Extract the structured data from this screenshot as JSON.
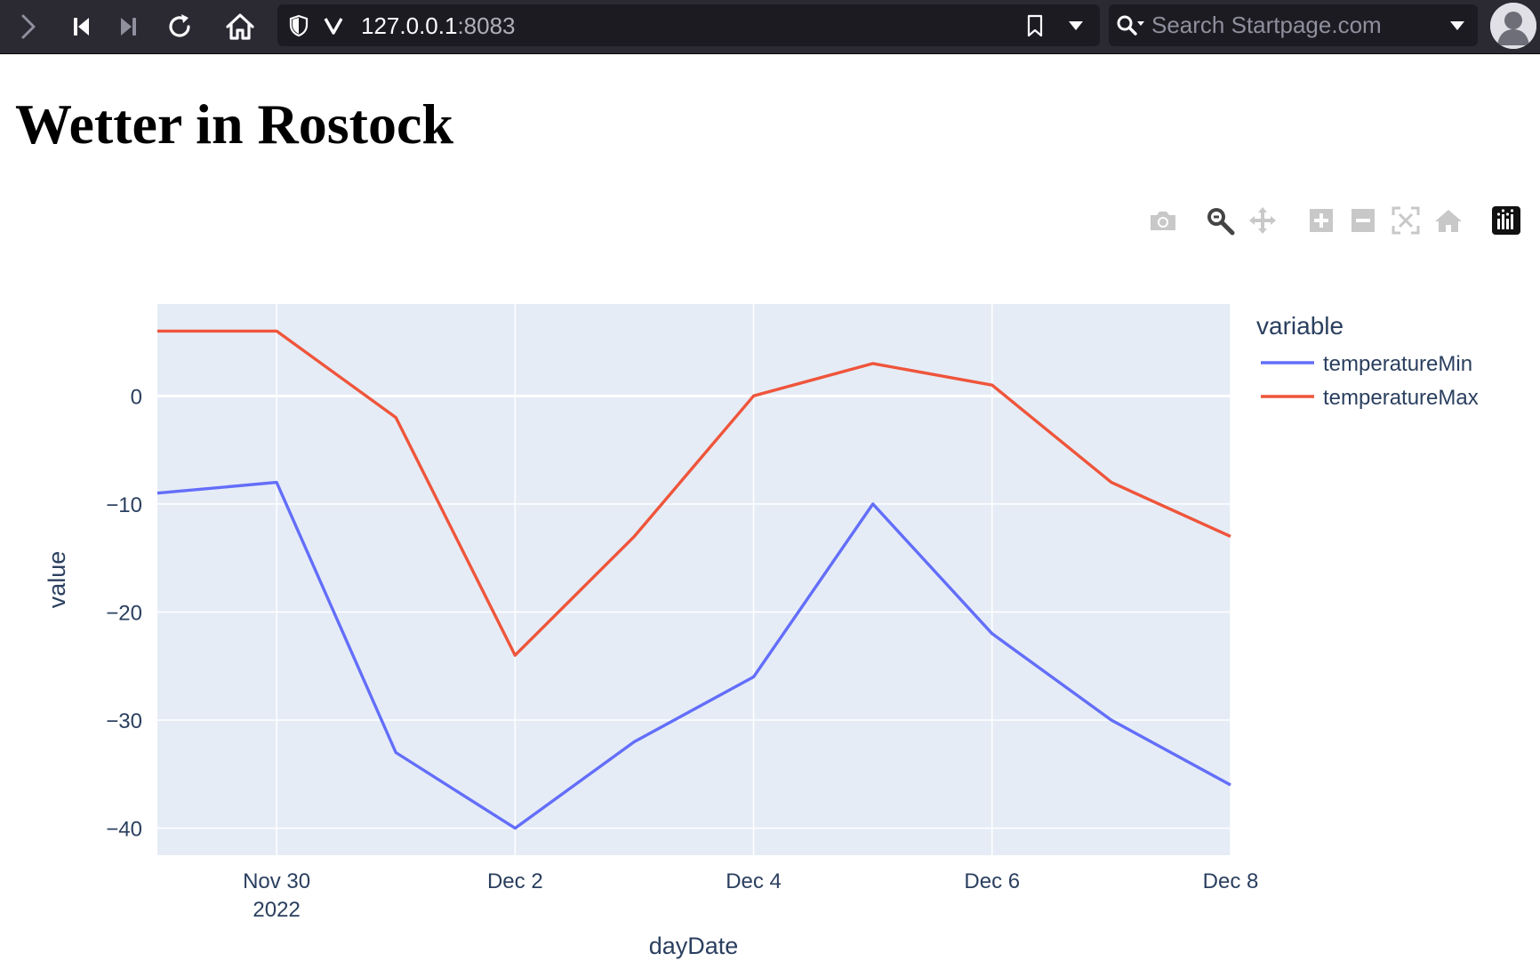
{
  "browser": {
    "url_host": "127.0.0.1",
    "url_port": ":8083",
    "search_placeholder": "Search Startpage.com"
  },
  "page": {
    "title": "Wetter in Rostock"
  },
  "modebar": {
    "buttons": [
      "camera-icon",
      "zoom-icon",
      "pan-icon",
      "zoom-in-icon",
      "zoom-out-icon",
      "autoscale-icon",
      "reset-axes-icon",
      "plotly-logo-icon"
    ],
    "active": "zoom-icon"
  },
  "chart_data": {
    "type": "line",
    "x": [
      "2022-11-29",
      "2022-11-30",
      "2022-12-01",
      "2022-12-02",
      "2022-12-03",
      "2022-12-04",
      "2022-12-05",
      "2022-12-06",
      "2022-12-07",
      "2022-12-08"
    ],
    "series": [
      {
        "name": "temperatureMin",
        "color": "#636efa",
        "values": [
          -9,
          -8,
          -33,
          -40,
          -32,
          -26,
          -10,
          -22,
          -30,
          -36
        ]
      },
      {
        "name": "temperatureMax",
        "color": "#ef553b",
        "values": [
          6,
          6,
          -2,
          -24,
          -13,
          0,
          3,
          1,
          -8,
          -13
        ]
      }
    ],
    "xlabel": "dayDate",
    "ylabel": "value",
    "legend_title": "variable",
    "legend_position": "right",
    "xticks": [
      {
        "date": "2022-11-30",
        "label": "Nov 30",
        "sublabel": "2022"
      },
      {
        "date": "2022-12-02",
        "label": "Dec 2",
        "sublabel": ""
      },
      {
        "date": "2022-12-04",
        "label": "Dec 4",
        "sublabel": ""
      },
      {
        "date": "2022-12-06",
        "label": "Dec 6",
        "sublabel": ""
      },
      {
        "date": "2022-12-08",
        "label": "Dec 8",
        "sublabel": ""
      }
    ],
    "yticks": [
      {
        "value": 0,
        "label": "0"
      },
      {
        "value": -10,
        "label": "−10"
      },
      {
        "value": -20,
        "label": "−20"
      },
      {
        "value": -30,
        "label": "−30"
      },
      {
        "value": -40,
        "label": "−40"
      }
    ],
    "xlim": [
      "2022-11-29",
      "2022-12-08"
    ],
    "ylim": [
      -42.5,
      8.5
    ],
    "grid": true,
    "background": "#e5ecf6"
  }
}
